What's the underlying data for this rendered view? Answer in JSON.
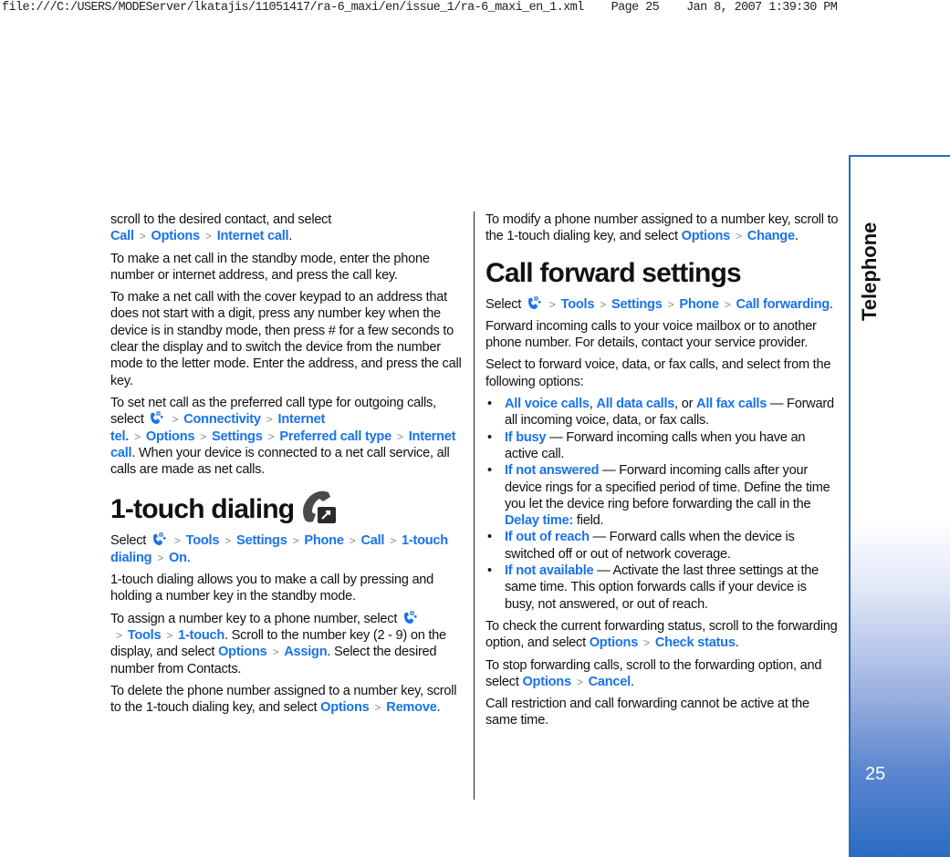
{
  "print_header": {
    "path": "file:///C:/USERS/MODEServer/lkatajis/11051417/ra-6_maxi/en/issue_1/ra-6_maxi_en_1.xml",
    "page": "Page 25",
    "timestamp": "Jan 8, 2007 1:39:30 PM"
  },
  "sidebar": {
    "section": "Telephone",
    "page_number": "25",
    "accent_color": "#2a6cc2"
  },
  "link_color": "#1a73e8",
  "separator": ">",
  "left": {
    "p1": {
      "t1": "scroll to the desired contact, and select ",
      "l1": "Call",
      "l2": "Options",
      "l3": "Internet call",
      "t2": "."
    },
    "p2": "To make a net call in the standby mode, enter the phone number or internet address, and press the call key.",
    "p3": "To make a net call with the cover keypad to an address that does not start with a digit, press any number key when the device is in standby mode, then press # for a few seconds to clear the display and to switch the device from the number mode to the letter mode. Enter the address, and press the call key.",
    "p4": {
      "t1": "To set net call as the preferred call type for outgoing calls, select ",
      "l1": "Connectivity",
      "l2": "Internet tel.",
      "l3": "Options",
      "l4": "Settings",
      "l5": "Preferred call type",
      "l6": "Internet call",
      "t2": ". When your device is connected to a net call service, all calls are made as net calls."
    },
    "heading": "1-touch dialing",
    "p5": {
      "t1": "Select ",
      "l1": "Tools",
      "l2": "Settings",
      "l3": "Phone",
      "l4": "Call",
      "l5": "1-touch dialing",
      "l6": "On",
      "t2": "."
    },
    "p6": "1-touch dialing allows you to make a call by pressing and holding a number key in the standby mode.",
    "p7": {
      "t1": "To assign a number key to a phone number, select ",
      "l1": "Tools",
      "l2": "1-touch",
      "t2": ". Scroll to the number key (2 - 9) on the display, and select ",
      "l3": "Options",
      "l4": "Assign",
      "t3": ". Select the desired number from Contacts."
    },
    "p8": {
      "t1": "To delete the phone number assigned to a number key, scroll to the 1-touch dialing key, and select ",
      "l1": "Options",
      "l2": "Remove",
      "t2": "."
    }
  },
  "right": {
    "p1": {
      "t1": "To modify a phone number assigned to a number key, scroll to the 1-touch dialing key, and select ",
      "l1": "Options",
      "l2": "Change",
      "t2": "."
    },
    "heading": "Call forward settings",
    "p2": {
      "t1": "Select ",
      "l1": "Tools",
      "l2": "Settings",
      "l3": "Phone",
      "l4": "Call forwarding",
      "t2": "."
    },
    "p3": "Forward incoming calls to your voice mailbox or to another phone number. For details, contact your service provider.",
    "p4": "Select to forward voice, data, or fax calls, and select from the following options:",
    "bullets": [
      {
        "l1": "All voice calls",
        "t1": ", ",
        "l2": "All data calls",
        "t2": ", or ",
        "l3": "All fax calls",
        "t3": " — Forward all incoming voice, data, or fax calls."
      },
      {
        "l1": "If busy",
        "t1": " — Forward incoming calls when you have an active call."
      },
      {
        "l1": "If not answered",
        "t1": " — Forward incoming calls after your device rings for a specified period of time. Define the time you let the device ring before forwarding the call in the ",
        "l2": "Delay time:",
        "t2": " field."
      },
      {
        "l1": "If out of reach",
        "t1": " — Forward calls when the device is switched off or out of network coverage."
      },
      {
        "l1": "If not available",
        "t1": " — Activate the last three settings at the same time. This option forwards calls if your device is busy, not answered, or out of reach."
      }
    ],
    "p5": {
      "t1": "To check the current forwarding status, scroll to the forwarding option, and select ",
      "l1": "Options",
      "l2": "Check status",
      "t2": "."
    },
    "p6": {
      "t1": "To stop forwarding calls, scroll to the forwarding option, and select ",
      "l1": "Options",
      "l2": "Cancel",
      "t2": "."
    },
    "p7": "Call restriction and call forwarding cannot be active at the same time."
  }
}
